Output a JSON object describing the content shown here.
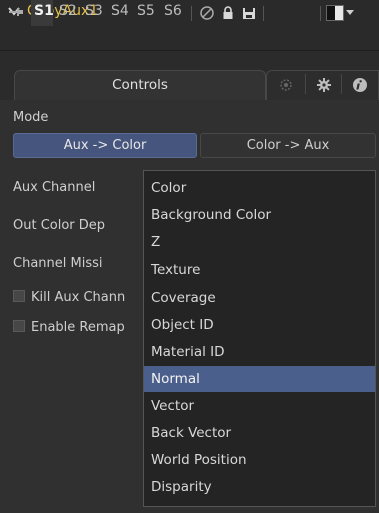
{
  "header": {
    "title": "CopyAux1"
  },
  "toolbar": {
    "slots": [
      "S1",
      "S2",
      "S3",
      "S4",
      "S5",
      "S6"
    ],
    "active_slot": "S1"
  },
  "tabs": {
    "controls_label": "Controls"
  },
  "mode": {
    "label": "Mode",
    "options": [
      "Aux -> Color",
      "Color -> Aux"
    ],
    "selected": "Aux -> Color"
  },
  "fields": {
    "aux_channel": "Aux Channel",
    "out_color_depth": "Out Color Dep",
    "channel_missing": "Channel Missi"
  },
  "checkboxes": {
    "kill_aux": "Kill Aux Chann",
    "enable_remap": "Enable Remap"
  },
  "dropdown": {
    "options": [
      "Color",
      "Background Color",
      "Z",
      "Texture",
      "Coverage",
      "Object ID",
      "Material ID",
      "Normal",
      "Vector",
      "Back Vector",
      "World Position",
      "Disparity"
    ],
    "selected": "Normal"
  },
  "colors": {
    "title": "#e6c04a",
    "accent": "#46557d",
    "selection": "#4a5f8c"
  }
}
